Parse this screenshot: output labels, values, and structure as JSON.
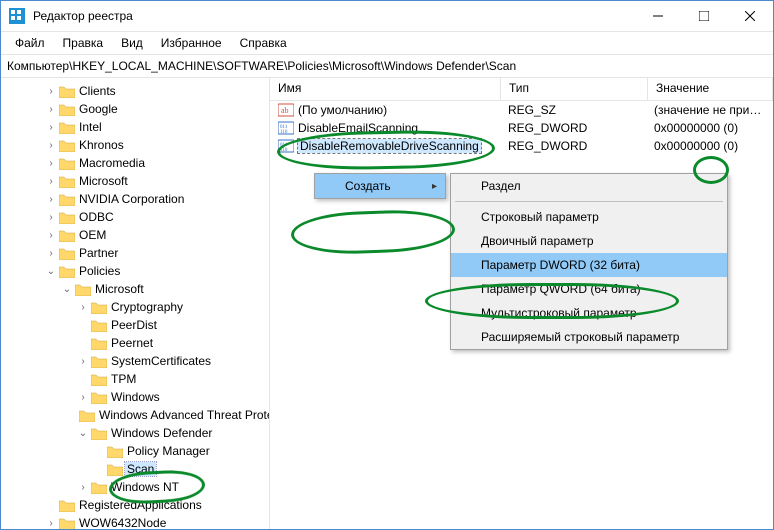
{
  "window": {
    "title": "Редактор реестра"
  },
  "menubar": [
    "Файл",
    "Правка",
    "Вид",
    "Избранное",
    "Справка"
  ],
  "addressbar": "Компьютер\\HKEY_LOCAL_MACHINE\\SOFTWARE\\Policies\\Microsoft\\Windows Defender\\Scan",
  "columns": {
    "name": "Имя",
    "type": "Тип",
    "value": "Значение"
  },
  "values": [
    {
      "icon": "string",
      "name": "(По умолчанию)",
      "type": "REG_SZ",
      "value": "(значение не присвоено)",
      "selected": false
    },
    {
      "icon": "dword",
      "name": "DisableEmailScanning",
      "type": "REG_DWORD",
      "value": "0x00000000 (0)",
      "selected": false
    },
    {
      "icon": "dword",
      "name": "DisableRemovableDriveScanning",
      "type": "REG_DWORD",
      "value": "0x00000000 (0)",
      "selected": true
    }
  ],
  "contextmenu": {
    "create": "Создать",
    "sub": [
      "Раздел",
      "-",
      "Строковый параметр",
      "Двоичный параметр",
      "Параметр DWORD (32 бита)",
      "Параметр QWORD (64 бита)",
      "Мультистроковый параметр",
      "Расширяемый строковый параметр"
    ],
    "highlighted_index": 4
  },
  "tree": [
    {
      "label": "Clients",
      "expand": ">"
    },
    {
      "label": "Google",
      "expand": ">"
    },
    {
      "label": "Intel",
      "expand": ">"
    },
    {
      "label": "Khronos",
      "expand": ">"
    },
    {
      "label": "Macromedia",
      "expand": ">"
    },
    {
      "label": "Microsoft",
      "expand": ">"
    },
    {
      "label": "NVIDIA Corporation",
      "expand": ">"
    },
    {
      "label": "ODBC",
      "expand": ">"
    },
    {
      "label": "OEM",
      "expand": ">"
    },
    {
      "label": "Partner",
      "expand": ">"
    },
    {
      "label": "Policies",
      "expand": "v",
      "children": [
        {
          "label": "Microsoft",
          "expand": "v",
          "children": [
            {
              "label": "Cryptography",
              "expand": ">"
            },
            {
              "label": "PeerDist",
              "expand": ""
            },
            {
              "label": "Peernet",
              "expand": ""
            },
            {
              "label": "SystemCertificates",
              "expand": ">"
            },
            {
              "label": "TPM",
              "expand": ""
            },
            {
              "label": "Windows",
              "expand": ">"
            },
            {
              "label": "Windows Advanced Threat Protection",
              "expand": ""
            },
            {
              "label": "Windows Defender",
              "expand": "v",
              "children": [
                {
                  "label": "Policy Manager",
                  "expand": ""
                },
                {
                  "label": "Scan",
                  "expand": "",
                  "selected": true
                }
              ]
            },
            {
              "label": "Windows NT",
              "expand": ">"
            }
          ]
        }
      ]
    },
    {
      "label": "RegisteredApplications",
      "expand": ""
    },
    {
      "label": "WOW6432Node",
      "expand": ">"
    }
  ]
}
